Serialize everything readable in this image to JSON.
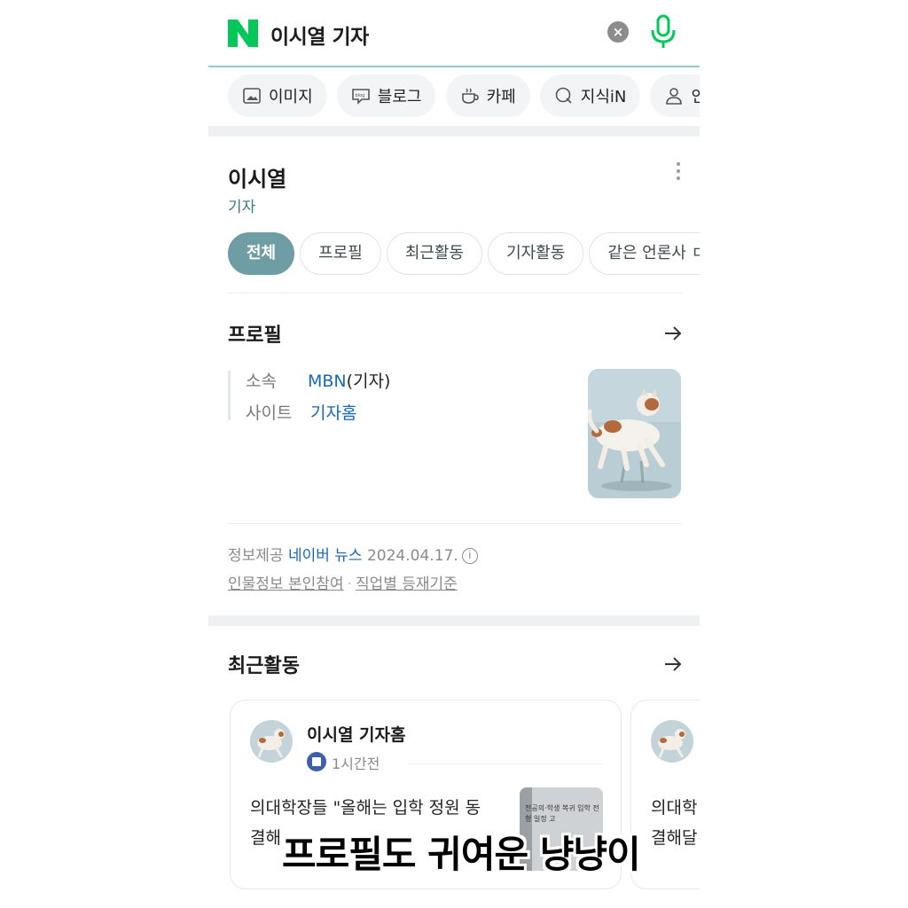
{
  "search": {
    "query": "이시열 기자",
    "clear_icon": "close-icon",
    "mic_icon": "microphone-icon",
    "brand_color": "#03c75a"
  },
  "categories": [
    {
      "label": "이미지",
      "icon": "image-icon"
    },
    {
      "label": "블로그",
      "icon": "blog-icon"
    },
    {
      "label": "카페",
      "icon": "cafe-cup-icon"
    },
    {
      "label": "지식iN",
      "icon": "knowledge-icon"
    },
    {
      "label": "인",
      "icon": "person-icon"
    }
  ],
  "person": {
    "name": "이시열",
    "role": "기자"
  },
  "tabs": [
    "전체",
    "프로필",
    "최근활동",
    "기자활동",
    "같은 언론사 ㄷ"
  ],
  "profile": {
    "title": "프로필",
    "affiliation_label": "소속",
    "affiliation_link": "MBN",
    "affiliation_suffix": "(기자)",
    "site_label": "사이트",
    "site_link": "기자홈"
  },
  "source": {
    "prefix": "정보제공",
    "provider": "네이버 뉴스",
    "date": "2024.04.17.",
    "link1": "인물정보 본인참여",
    "sep": "·",
    "link2": "직업별 등재기준"
  },
  "recent": {
    "title": "최근활동",
    "card": {
      "author": "이시열 기자홈",
      "time": "1시간전",
      "headline_line1": "의대학장들 \"올해는 입학 정원 동",
      "headline_line2": "결해",
      "thumb_text": "전공의·학생 복귀 입학 전형 일정 고"
    },
    "card2_line1": "의대학",
    "card2_line2": "결해달"
  },
  "caption": "프로필도 귀여운 냥냥이"
}
